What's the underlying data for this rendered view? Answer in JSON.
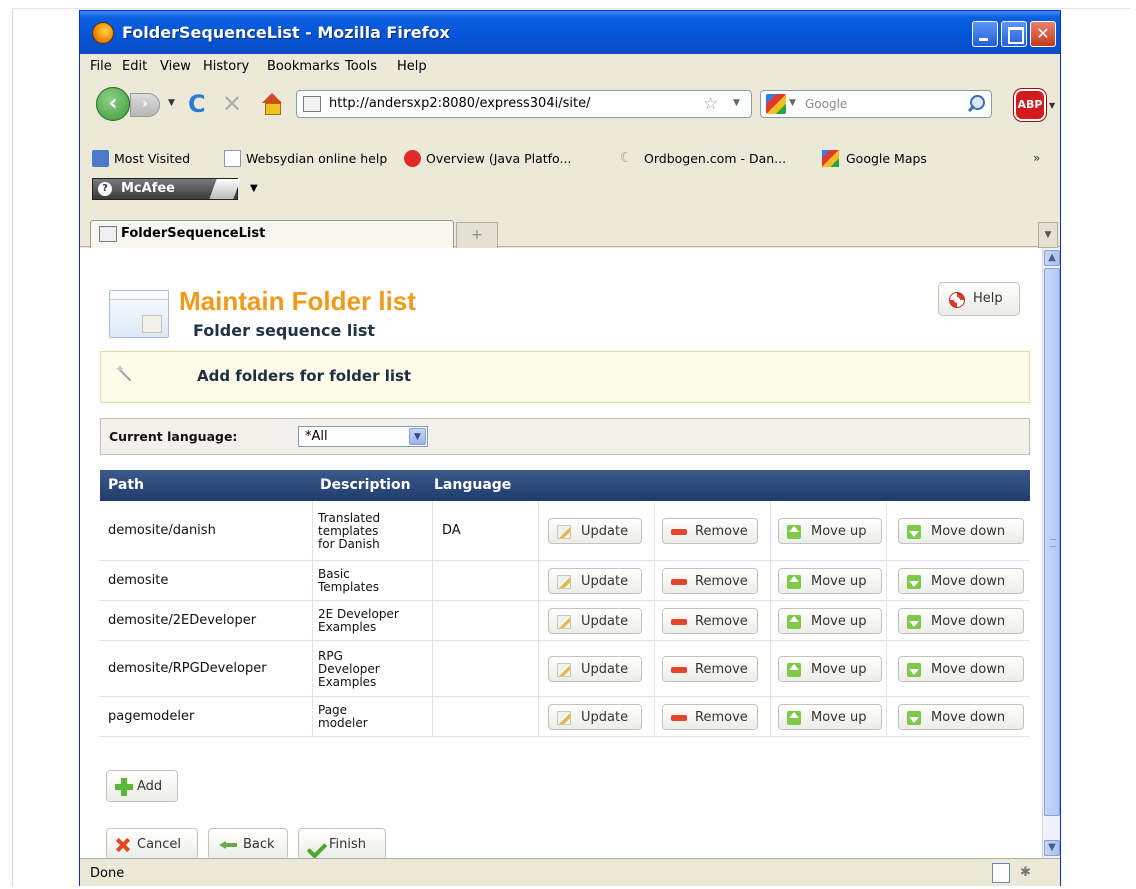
{
  "window": {
    "title": "FolderSequenceList - Mozilla Firefox",
    "menu": [
      "File",
      "Edit",
      "View",
      "History",
      "Bookmarks",
      "Tools",
      "Help"
    ]
  },
  "nav": {
    "url": "http://andersxp2:8080/express304i/site/",
    "search_placeholder": "Google",
    "adblock_label": "ABP"
  },
  "bookmarks": [
    "Most Visited",
    "Websydian online help",
    "Overview (Java Platfo...",
    "Ordbogen.com - Dan...",
    "Google Maps"
  ],
  "toolbar_extra": {
    "mcafee_label": "McAfee"
  },
  "tabs": {
    "active": "FolderSequenceList"
  },
  "page": {
    "title": "Maintain Folder list",
    "subtitle": "Folder sequence list",
    "help_label": "Help",
    "info_text": "Add folders for folder list",
    "language_label": "Current language:",
    "language_value": "*All",
    "columns": [
      "Path",
      "Description",
      "Language"
    ],
    "rows": [
      {
        "path": "demosite/danish",
        "description": [
          "Translated",
          "templates",
          "for Danish"
        ],
        "language": "DA"
      },
      {
        "path": "demosite",
        "description": [
          "Basic",
          "Templates"
        ],
        "language": ""
      },
      {
        "path": "demosite/2EDeveloper",
        "description": [
          "2E Developer",
          "Examples"
        ],
        "language": ""
      },
      {
        "path": "demosite/RPGDeveloper",
        "description": [
          "RPG",
          "Developer",
          "Examples"
        ],
        "language": ""
      },
      {
        "path": "pagemodeler",
        "description": [
          "Page",
          "modeler"
        ],
        "language": ""
      }
    ],
    "row_buttons": {
      "update": "Update",
      "remove": "Remove",
      "move_up": "Move up",
      "move_down": "Move down"
    },
    "add_label": "Add",
    "cancel_label": "Cancel",
    "back_label": "Back",
    "finish_label": "Finish"
  },
  "status": {
    "text": "Done"
  }
}
